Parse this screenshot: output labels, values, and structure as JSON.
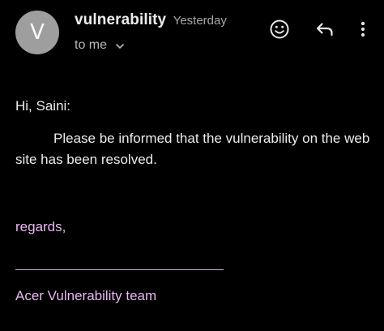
{
  "header": {
    "avatar_letter": "V",
    "subject": "vulnerability",
    "timestamp": "Yesterday",
    "recipient": "to me",
    "actions": {
      "emoji_icon": "emoji-smile-icon",
      "reply_icon": "reply-icon",
      "more_icon": "more-vert-icon"
    }
  },
  "message": {
    "greeting": "Hi, Saini:",
    "body": "Please be informed that the vulnerability on the web site has been resolved.",
    "signoff": "regards,",
    "signature": "Acer Vulnerability team"
  },
  "colors": {
    "background": "#000000",
    "avatar": "#9e9e9e",
    "signature": "#eab8f5",
    "text": "#ececec"
  }
}
